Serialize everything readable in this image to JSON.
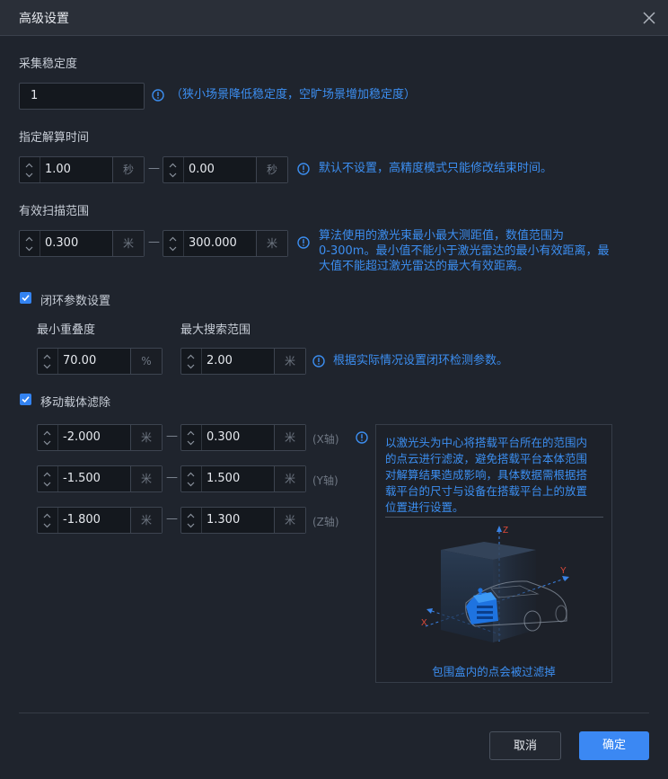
{
  "dialog": {
    "title": "高级设置"
  },
  "stability": {
    "label": "采集稳定度",
    "value": "1",
    "hint": "（狭小场景降低稳定度，空旷场景增加稳定度）"
  },
  "solve_time": {
    "label": "指定解算时间",
    "start": "1.00",
    "end": "0.00",
    "unit": "秒",
    "hint": "默认不设置，高精度模式只能修改结束时间。"
  },
  "scan_range": {
    "label": "有效扫描范围",
    "min": "0.300",
    "max": "300.000",
    "unit": "米",
    "hint_lines": [
      "算法使用的激光束最小最大测距值，数值范围为",
      "0-300m。最小值不能小于激光雷达的最小有效距离，最",
      "大值不能超过激光雷达的最大有效距离。"
    ]
  },
  "loop_closure": {
    "checked": true,
    "label": "闭环参数设置",
    "overlap_label": "最小重叠度",
    "overlap": "70.00",
    "overlap_unit": "%",
    "search_label": "最大搜索范围",
    "search": "2.00",
    "search_unit": "米",
    "hint": "根据实际情况设置闭环检测参数。"
  },
  "carrier_filter": {
    "checked": true,
    "label": "移动载体滤除",
    "unit": "米",
    "rows": [
      {
        "min": "-2.000",
        "max": "0.300",
        "axis": "(X轴)"
      },
      {
        "min": "-1.500",
        "max": "1.500",
        "axis": "(Y轴)"
      },
      {
        "min": "-1.800",
        "max": "1.300",
        "axis": "(Z轴)"
      }
    ],
    "panel_lines": [
      "以激光头为中心将搭载平台所在的范围内",
      "的点云进行滤波，避免搭载平台本体范围",
      "对解算结果造成影响，具体数据需根据搭",
      "载平台的尺寸与设备在搭载平台上的放置",
      "位置进行设置。"
    ],
    "axis_x": "X",
    "axis_y": "Y",
    "axis_z": "Z",
    "caption": "包围盒内的点会被过滤掉"
  },
  "range_separator": "—",
  "footer": {
    "cancel": "取消",
    "ok": "确定"
  },
  "colors": {
    "accent": "#3b88f3",
    "hint": "#3c8ef0",
    "axis": "#e04a3a",
    "background": "#1f242d"
  },
  "icons": {
    "close": "close-icon",
    "info": "info-icon",
    "stepper": "chevron-up-down-icon",
    "check": "check-icon"
  }
}
